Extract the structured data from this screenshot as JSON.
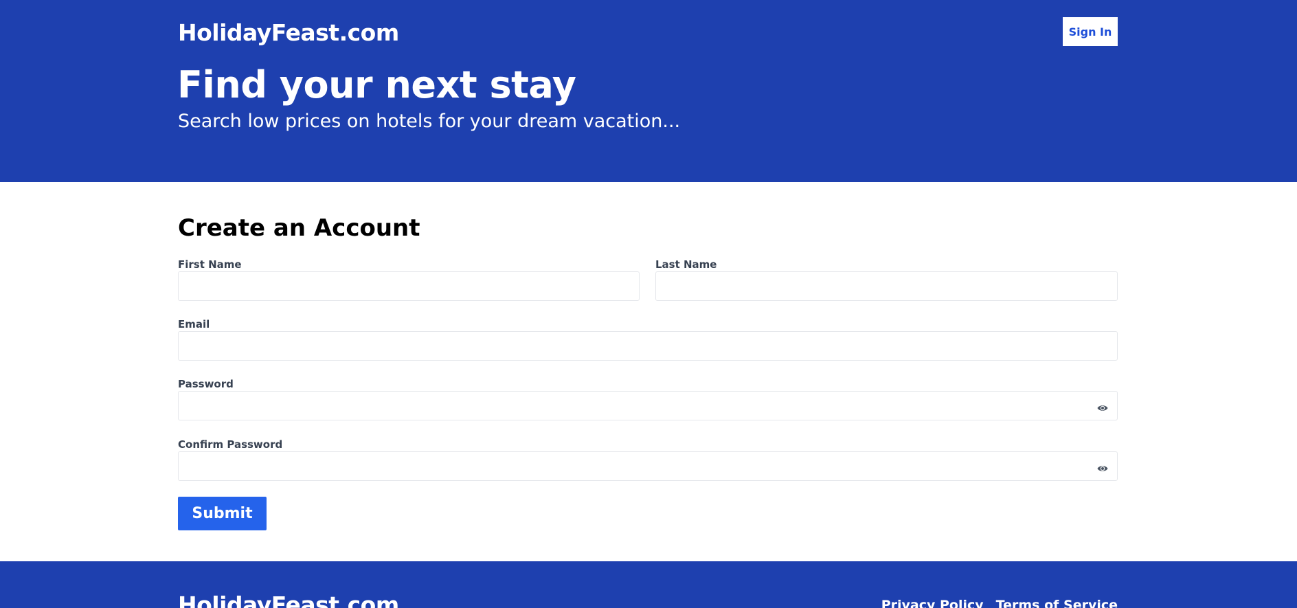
{
  "header": {
    "logo": "HolidayFeast.com",
    "sign_in_label": "Sign In"
  },
  "hero": {
    "title": "Find your next stay",
    "subtitle": "Search low prices on hotels for your dream vacation..."
  },
  "form": {
    "title": "Create an Account",
    "first_name_label": "First Name",
    "first_name_value": "",
    "last_name_label": "Last Name",
    "last_name_value": "",
    "email_label": "Email",
    "email_value": "",
    "password_label": "Password",
    "password_value": "",
    "confirm_password_label": "Confirm Password",
    "confirm_password_value": "",
    "submit_label": "Submit",
    "toggle_icon": "eye-icon"
  },
  "footer": {
    "logo": "HolidayFeast.com",
    "links": [
      "Privacy Policy",
      "Terms of Service"
    ]
  },
  "colors": {
    "brand_blue": "#1e40af",
    "button_blue": "#2563eb",
    "sign_in_text": "#1d4ed8"
  }
}
